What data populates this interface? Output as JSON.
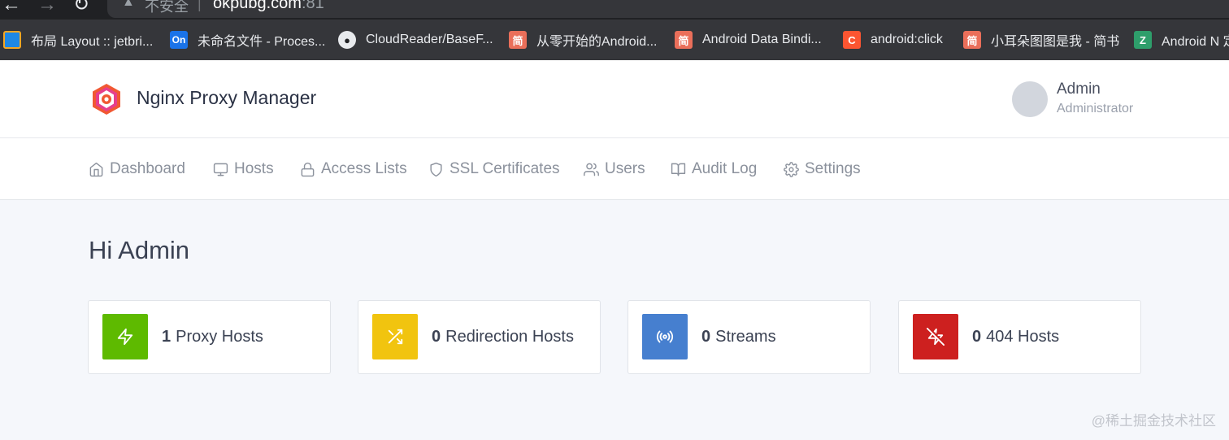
{
  "browser": {
    "url_insecure_label": "不安全",
    "url_separator": "|",
    "url_host": "okpubg.com",
    "url_port": ":81",
    "bookmarks": [
      {
        "label": "布局 Layout :: jetbri...",
        "icon": "jetbrains-icon",
        "color": "#1e88e5"
      },
      {
        "label": "未命名文件 - Proces...",
        "icon": "processon-icon",
        "color": "#1a73e8"
      },
      {
        "label": "CloudReader/BaseF...",
        "icon": "github-icon",
        "color": "#e8eaed"
      },
      {
        "label": "从零开始的Android...",
        "icon": "jianshu-icon",
        "color": "#ea6f5a"
      },
      {
        "label": "Android Data Bindi...",
        "icon": "jianshu-icon",
        "color": "#ea6f5a"
      },
      {
        "label": "android:click",
        "icon": "csdn-icon",
        "color": "#fc5531"
      },
      {
        "label": "小耳朵图图是我 - 简书",
        "icon": "jianshu-icon",
        "color": "#ea6f5a"
      },
      {
        "label": "Android N 定",
        "icon": "bookmark-site-icon",
        "color": "#2e9e6b"
      }
    ]
  },
  "header": {
    "brand": "Nginx Proxy Manager",
    "user_name": "Admin",
    "user_role": "Administrator"
  },
  "nav": [
    {
      "label": "Dashboard",
      "icon": "home-icon"
    },
    {
      "label": "Hosts",
      "icon": "monitor-icon"
    },
    {
      "label": "Access Lists",
      "icon": "lock-icon"
    },
    {
      "label": "SSL Certificates",
      "icon": "shield-icon"
    },
    {
      "label": "Users",
      "icon": "users-icon"
    },
    {
      "label": "Audit Log",
      "icon": "book-icon"
    },
    {
      "label": "Settings",
      "icon": "settings-icon"
    }
  ],
  "greeting": "Hi Admin",
  "cards": [
    {
      "count": "1",
      "label": "Proxy Hosts",
      "icon": "zap-icon",
      "color": "#5eba00"
    },
    {
      "count": "0",
      "label": "Redirection Hosts",
      "icon": "shuffle-icon",
      "color": "#f1c40f"
    },
    {
      "count": "0",
      "label": "Streams",
      "icon": "radio-icon",
      "color": "#467fcf"
    },
    {
      "count": "0",
      "label": "404 Hosts",
      "icon": "zap-off-icon",
      "color": "#cd201f"
    }
  ],
  "watermark": "@稀土掘金技术社区"
}
